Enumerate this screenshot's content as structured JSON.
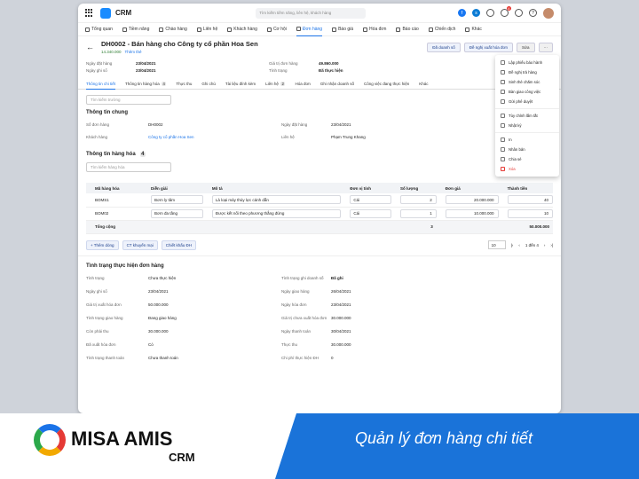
{
  "app": {
    "name": "CRM",
    "search_placeholder": "Tìm kiếm tiềm năng, liên hệ, khách hàng",
    "notif": "4"
  },
  "nav": [
    "Tổng quan",
    "Tiềm năng",
    "Chào hàng",
    "Liên hệ",
    "Khách hàng",
    "Cơ hội",
    "Đơn hàng",
    "Báo giá",
    "Hóa đơn",
    "Báo cáo",
    "Chiến dịch",
    "Khác"
  ],
  "record": {
    "title": "DH0002 - Bán hàng cho Công ty cổ phần Hoa Sen",
    "amount": "14.340.000",
    "tag": "Thêm thẻ",
    "btn_status": "Đã doanh số",
    "btn_invoice": "Đề nghị xuất hóa đơn",
    "btn_edit": "Sửa",
    "btn_more": "···"
  },
  "summary": [
    [
      "Ngày đặt hàng",
      "23/04/2021",
      "Giá trị đơn hàng",
      "49.860.000"
    ],
    [
      "Ngày ghi sổ",
      "23/04/2021",
      "Tình trạng",
      "Đã thực hiện"
    ]
  ],
  "tabs": [
    {
      "l": "Thông tin chi tiết",
      "c": ""
    },
    {
      "l": "Thông tin hàng hóa",
      "c": "4"
    },
    {
      "l": "Thực thu",
      "c": ""
    },
    {
      "l": "Ghi chú",
      "c": ""
    },
    {
      "l": "Tài liệu đính kèm",
      "c": ""
    },
    {
      "l": "Liên hệ",
      "c": "2"
    },
    {
      "l": "Hóa đơn",
      "c": ""
    },
    {
      "l": "Ghi nhận doanh số",
      "c": ""
    },
    {
      "l": "Công việc đang thực hiện",
      "c": ""
    },
    {
      "l": "Khác",
      "c": ""
    }
  ],
  "field_search": "Tìm kiếm trường",
  "general": {
    "title": "Thông tin chung",
    "rows": [
      [
        "Số đơn hàng",
        "DH0002",
        "Ngày đặt hàng",
        "23/04/2021"
      ],
      [
        "Khách hàng",
        "Công ty cổ phần Hoa Sen",
        "Liên hệ",
        "Phạm Trung Khang"
      ]
    ]
  },
  "goods": {
    "title": "Thông tin hàng hóa",
    "count": "4",
    "search": "Tìm kiếm hàng hóa",
    "add": "+ Chọn hàng hóa",
    "cols": [
      "Mã hàng hóa",
      "Diễn giải",
      "Mô tả",
      "Đơn vị tính",
      "Số lượng",
      "Đơn giá",
      "Thành tiền"
    ],
    "rows": [
      [
        "BOMS1",
        "Bơm ly tâm",
        "Là loại máy thủy lực cánh dẫn",
        "Cái",
        "2",
        "20.000.000",
        "40"
      ],
      [
        "BOM02",
        "Bơm đa tầng",
        "Được kết nối theo phương thẳng đứng",
        "Cái",
        "1",
        "10.000.000",
        "10"
      ]
    ],
    "total": [
      "Tổng cộng",
      "3",
      "50.000.000"
    ]
  },
  "actions": [
    "+ Thêm dòng",
    "CT khuyến mại",
    "Chiết khấu ĐH"
  ],
  "pager": {
    "size": "10",
    "range": "1 đến 4"
  },
  "status": {
    "title": "Tình trạng thực hiện đơn hàng",
    "rows": [
      [
        "Tình trạng",
        "Chưa thực hiện",
        "Tình trạng ghi doanh số",
        "Đã ghi"
      ],
      [
        "Ngày ghi sổ",
        "23/04/2021",
        "Ngày giao hàng",
        "26/04/2021"
      ],
      [
        "Giá trị xuất hóa đơn",
        "50.000.000",
        "Ngày hóa đơn",
        "23/04/2021"
      ],
      [
        "Tình trạng giao hàng",
        "Đang giao hàng",
        "Giá trị chưa xuất hóa đơn",
        "30.000.000"
      ],
      [
        "Còn phải thu",
        "30.000.000",
        "Ngày thanh toán",
        "30/04/2021"
      ],
      [
        "Đã xuất hóa đơn",
        "Có",
        "Thực thu",
        "30.000.000"
      ],
      [
        "Tình trạng thanh toán",
        "Chưa thanh toán",
        "Chi phí thực hiện ĐH",
        "0"
      ]
    ]
  },
  "menu": [
    "Lập phiếu báo hành",
    "Đề nghị trả hàng",
    "Sinh thẻ chăm sóc",
    "Bàn giao công việc",
    "Gửi phê duyệt",
    "Tùy chỉnh lắm tắt",
    "Nhật ký",
    "In",
    "Nhân bản",
    "Chia sẻ",
    "Xóa"
  ],
  "footer": {
    "brand": "MISA AMIS",
    "brand2": "CRM",
    "slogan": "Quản lý đơn hàng chi tiết"
  }
}
